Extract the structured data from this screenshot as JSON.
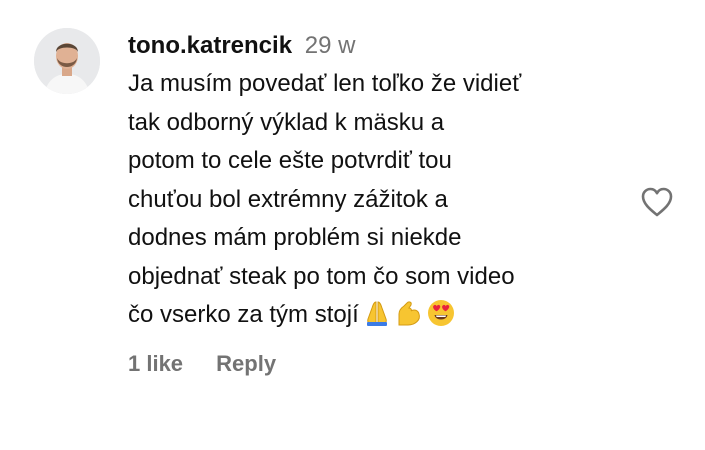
{
  "comment": {
    "username": "tono.katrencik",
    "time": "29 w",
    "lines": [
      "Ja musím povedať len toľko že vidieť",
      "tak odborný výklad k mäsku a",
      "potom to cele ešte potvrdiť tou",
      "chuťou bol extrémny zážitok a",
      "dodnes mám problém si niekde",
      "objednať steak po tom čo som video",
      "čo vserko za tým stojí"
    ],
    "emojis": [
      "folded-hands-emoji",
      "flexed-biceps-emoji",
      "heart-eyes-emoji"
    ],
    "likes_label": "1 like",
    "reply_label": "Reply"
  },
  "icons": {
    "like": "heart-outline-icon"
  },
  "colors": {
    "text": "#111111",
    "secondary": "#737373",
    "emoji_yellow": "#f7c531"
  }
}
